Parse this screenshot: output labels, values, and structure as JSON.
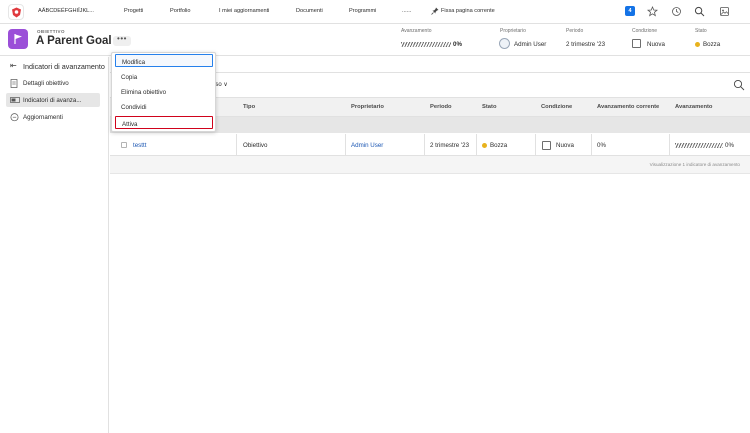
{
  "topnav": {
    "workspace": "AÄBCDEÉFGHIÏJKL...",
    "items": [
      "Progetti",
      "Portfolio",
      "I miei aggiornamenti",
      "Documenti",
      "Programmi",
      "......"
    ],
    "pin_label": "Fissa pagina corrente",
    "notification_count": "4",
    "icons": [
      "star-icon",
      "clock-icon",
      "search-icon",
      "grid-icon"
    ]
  },
  "header": {
    "type_label": "OBIETTIVO",
    "title": "A Parent Goal",
    "more_label": "•••",
    "fields": {
      "progress_label": "Avanzamento",
      "progress_value": "0%",
      "owner_label": "Proprietario",
      "owner_value": "Admin User",
      "period_label": "Periodo",
      "period_value": "2 trimestre '23",
      "condition_label": "Condizione",
      "condition_value": "Nuova",
      "status_label": "Stato",
      "status_value": "Bozza"
    },
    "status_color": "#e8b21d",
    "accent": "#9b4fd8"
  },
  "sidebar": {
    "back_label": "Indicatori di avanzamento",
    "items": [
      {
        "label": "Dettagli obiettivo",
        "icon": "document-icon"
      },
      {
        "label": "Indicatori di avanza...",
        "icon": "progress-bar-icon"
      },
      {
        "label": "Aggiornamenti",
        "icon": "chat-icon"
      }
    ]
  },
  "menu": {
    "items": [
      "Modifica",
      "Copia",
      "Elimina obiettivo",
      "Condividi",
      "Attiva"
    ]
  },
  "main": {
    "toolbar_fragment": "uso ∨",
    "columns": [
      "Tipo",
      "Proprietario",
      "Periodo",
      "Stato",
      "Condizione",
      "Avanzamento corrente",
      "Avanzamento"
    ],
    "row": {
      "name": "testtt",
      "type": "Obiettivo",
      "owner": "Admin User",
      "period": "2 trimestre '23",
      "status": "Bozza",
      "condition": "Nuova",
      "current_progress": "0%",
      "progress": "0%"
    },
    "footer": "Visualizzazione 1 indicatore di avanzamento"
  }
}
